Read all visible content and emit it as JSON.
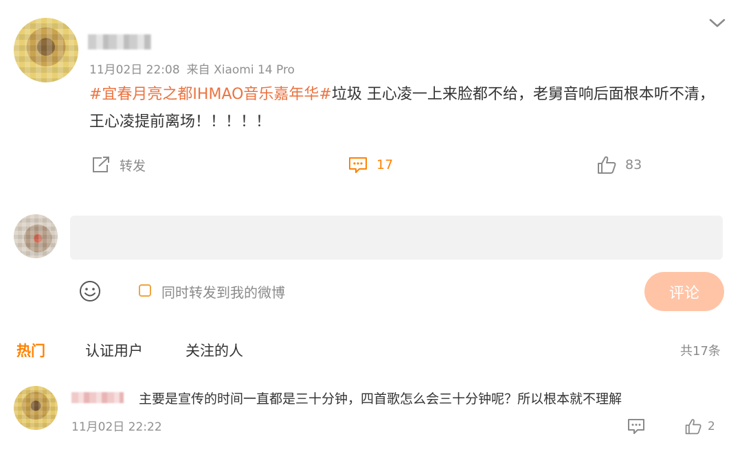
{
  "post": {
    "time": "11月02日 22:08",
    "source": "来自 Xiaomi 14 Pro",
    "hashtag": "#宜春月亮之都IHMAO音乐嘉年华#",
    "body": "垃圾 王心凌一上来脸都不给，老舅音响后面根本听不清，王心凌提前离场！！！！！",
    "actions": {
      "repost_label": "转发",
      "comment_count": "17",
      "like_count": "83"
    }
  },
  "composer": {
    "input_value": "",
    "also_repost_label": "同时转发到我的微博",
    "submit_label": "评论"
  },
  "comment_tabs": {
    "hot": "热门",
    "verified": "认证用户",
    "following": "关注的人",
    "total": "共17条"
  },
  "comments": [
    {
      "text": "主要是宣传的时间一直都是三十分钟，四首歌怎么会三十分钟呢？所以根本就不理解",
      "time": "11月02日 22:22",
      "like_count": "2"
    }
  ],
  "colors": {
    "accent": "#ff8200",
    "hashtag": "#eb7340",
    "submit_disabled": "#ffc4a6"
  }
}
